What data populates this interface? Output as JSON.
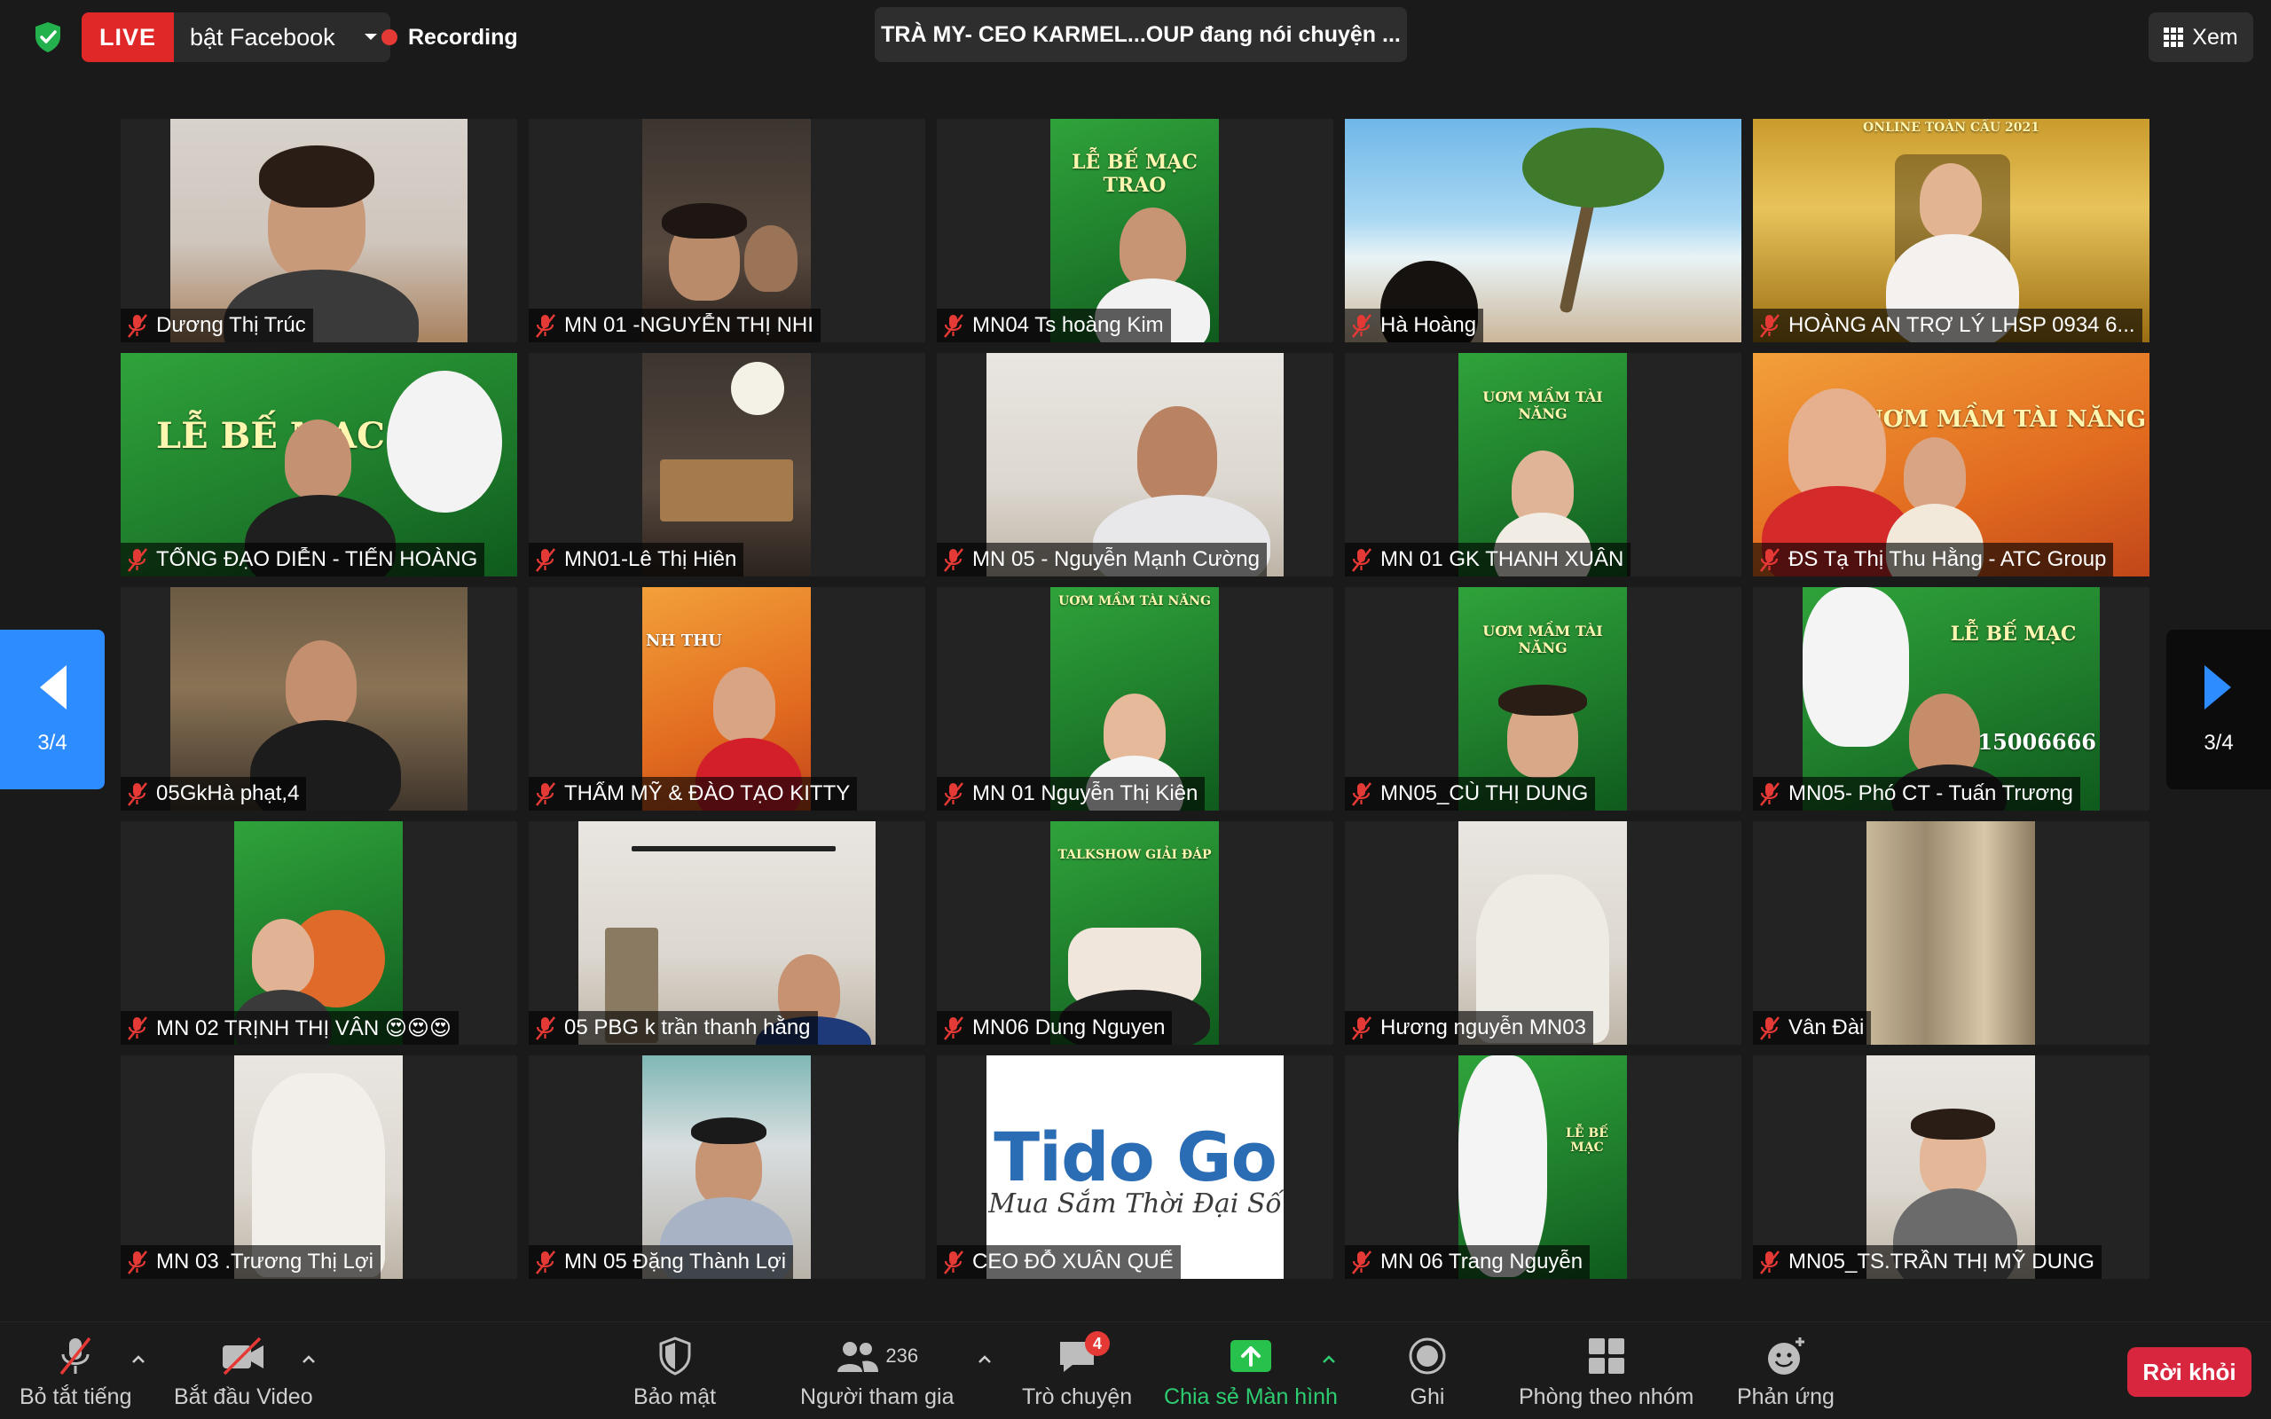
{
  "topbar": {
    "live_badge": "LIVE",
    "live_target": "bật Facebook",
    "recording_label": "Recording",
    "active_speaker": "TRÀ MY- CEO KARMEL...OUP đang nói chuyện ...",
    "view_label": "Xem"
  },
  "pagination": {
    "left": "3/4",
    "right": "3/4"
  },
  "participants": [
    "Dương Thị Trúc",
    "MN 01 -NGUYỄN THỊ NHI",
    "MN04 Ts hoàng Kim",
    "Hà Hoàng",
    "HOÀNG AN TRỢ LÝ LHSP 0934 6...",
    "TỔNG ĐẠO DIỄN - TIẾN HOÀNG",
    "MN01-Lê Thị Hiên",
    "MN 05 - Nguyễn Mạnh Cường",
    "MN 01 GK THANH XUÂN",
    "ĐS Tạ Thị Thu Hằng - ATC Group",
    "05GkHà phạt,4",
    "THẨM MỸ & ĐÀO TẠO KITTY",
    "MN 01 Nguyễn Thị Kiên",
    "MN05_CÙ THỊ DUNG",
    "MN05- Phó CT - Tuấn Trương",
    "MN 02 TRỊNH THỊ VÂN 😍😍😍",
    "05 PBG k trần thanh hằng",
    "MN06 Dung Nguyen",
    "Hương nguyễn MN03",
    "Vân Đài",
    "MN 03 .Trương Thị Lợi",
    "MN 05 Đặng Thành Lợi",
    "CEO ĐỖ XUÂN QUẾ",
    "MN 06 Trang Nguyễn",
    "MN05_TS.TRẦN THỊ MỸ DUNG"
  ],
  "feed_text": {
    "banner_a": "LỄ BẾ MẠC TRAO",
    "banner_b": "UƠM MẦM TÀI NĂNG",
    "banner_c": "LỄ BẾ MẠC",
    "banner_d": "ONLINE TOÀN CẦU 2021",
    "banner_e": "TALKSHOW GIẢI ĐÁP",
    "banner_f": "NH THU",
    "banner_g": "2015006666",
    "tidogo_logo": "Tido Go",
    "tidogo_tagline": "Mua Sắm Thời Đại Số"
  },
  "toolbar": {
    "mute": "Bỏ tắt tiếng",
    "video": "Bắt đầu Video",
    "security": "Bảo mật",
    "participants": "Người tham gia",
    "participants_count": "236",
    "chat": "Trò chuyện",
    "chat_badge": "4",
    "share": "Chia sẻ Màn hình",
    "record": "Ghi",
    "breakout": "Phòng theo nhóm",
    "reactions": "Phản ứng",
    "leave": "Rời khỏi"
  },
  "colors": {
    "live_red": "#e02828",
    "share_green": "#2ecc71",
    "nav_blue": "#2d8cff",
    "leave_red": "#d7263d",
    "muted_mic_red": "#e53935"
  }
}
